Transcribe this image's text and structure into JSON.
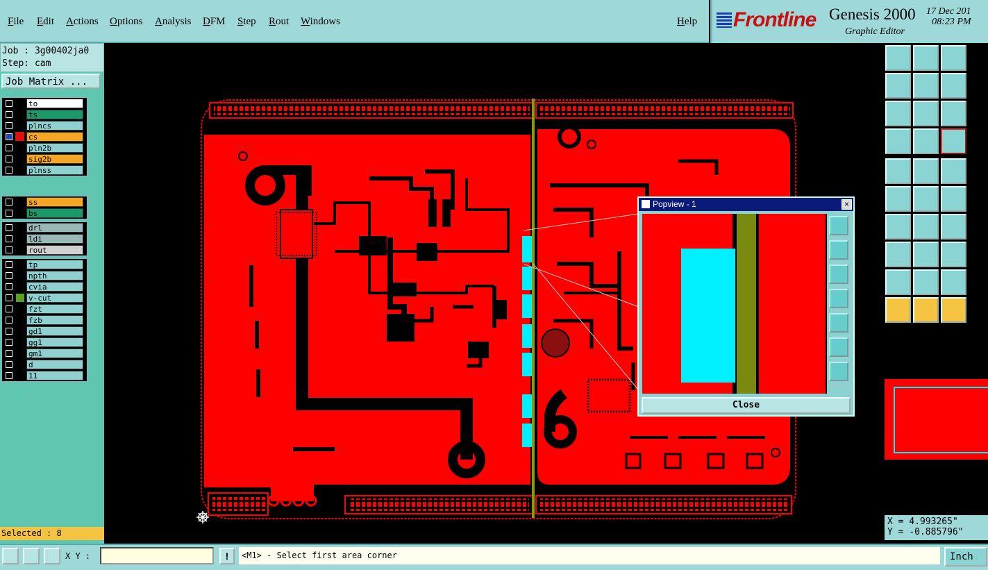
{
  "menu": [
    "File",
    "Edit",
    "Actions",
    "Options",
    "Analysis",
    "DFM",
    "Step",
    "Rout",
    "Windows"
  ],
  "help": "Help",
  "brand": {
    "logo": "Frontline",
    "app": "Genesis 2000",
    "subtitle": "Graphic Editor",
    "date": "17 Dec 201",
    "time": "08:23 PM"
  },
  "job": {
    "job_label": "Job : 3g00402ja0",
    "step_label": "Step: cam",
    "matrix_button": "Job Matrix ..."
  },
  "layers": {
    "group1": [
      {
        "name": "to",
        "bg": "#ffffff"
      },
      {
        "name": "ts",
        "bg": "#1a9a6a"
      },
      {
        "name": "plncs",
        "bg": "#8fd0d0"
      },
      {
        "name": "cs",
        "bg": "#f5a623"
      },
      {
        "name": "pln2b",
        "bg": "#8fd0d0"
      },
      {
        "name": "sig2b",
        "bg": "#f5a623"
      },
      {
        "name": "plnss",
        "bg": "#8fd0d0"
      }
    ],
    "group2": [
      {
        "name": "ss",
        "bg": "#f5a623"
      },
      {
        "name": "bs",
        "bg": "#1a9a6a"
      }
    ],
    "group3": [
      {
        "name": "drl",
        "bg": "#9ab8b8"
      },
      {
        "name": "ldi",
        "bg": "#9ab8b8"
      },
      {
        "name": "rout",
        "bg": "#d0d0d0"
      }
    ],
    "group4": [
      {
        "name": "tp",
        "bg": "#8fd0d0"
      },
      {
        "name": "npth",
        "bg": "#8fd0d0"
      },
      {
        "name": "cvia",
        "bg": "#8fd0d0"
      },
      {
        "name": "v-cut",
        "bg": "#8fd0d0"
      },
      {
        "name": "fzt",
        "bg": "#8fd0d0"
      },
      {
        "name": "fzb",
        "bg": "#8fd0d0"
      },
      {
        "name": "gd1",
        "bg": "#8fd0d0"
      },
      {
        "name": "gg1",
        "bg": "#8fd0d0"
      },
      {
        "name": "gm1",
        "bg": "#8fd0d0"
      },
      {
        "name": "d",
        "bg": "#8fd0d0"
      },
      {
        "name": "11",
        "bg": "#8fd0d0"
      }
    ]
  },
  "selected": "Selected : 8",
  "popview": {
    "title": "Popview - 1",
    "close_label": "Close"
  },
  "coords": {
    "x": "X = 4.993265\"",
    "y": "Y = -0.885796\""
  },
  "bottom": {
    "xy_label": "X Y :",
    "message": "<M1> - Select first area corner",
    "units": "Inch"
  },
  "colors": {
    "board": "#ff0000",
    "copper_void": "#000000",
    "highlight": "#00f0ff",
    "vcut": "#8a9a10",
    "panel": "#9fd8d8"
  }
}
